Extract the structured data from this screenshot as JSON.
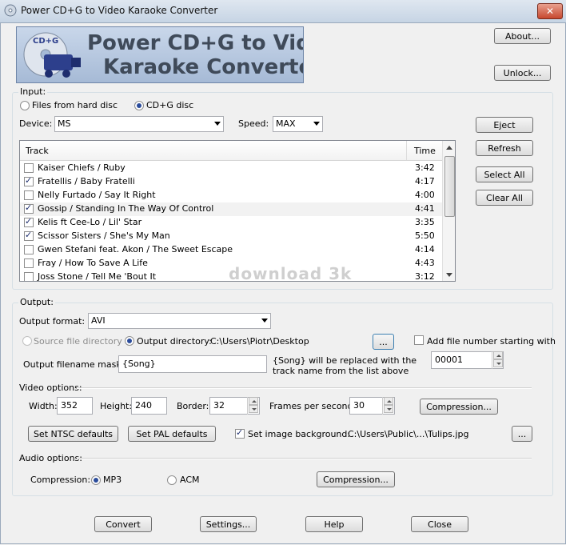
{
  "window": {
    "title": "Power CD+G to Video Karaoke Converter",
    "close_glyph": "✕"
  },
  "banner": {
    "line1": "Power CD+G to Video",
    "line2": "Karaoke Converter",
    "logo_text": "CD+G"
  },
  "buttons": {
    "about": "About...",
    "unlock": "Unlock...",
    "eject": "Eject",
    "refresh": "Refresh",
    "select_all": "Select All",
    "clear_all": "Clear All"
  },
  "input": {
    "group_label": "Input:",
    "source_hdd": "Files from hard disc",
    "source_cdg": "CD+G disc",
    "device_label": "Device:",
    "device_value": "MS",
    "speed_label": "Speed:",
    "speed_value": "MAX"
  },
  "tracklist": {
    "col_track": "Track",
    "col_time": "Time",
    "rows": [
      {
        "name": "Kaiser Chiefs / Ruby",
        "time": "3:42",
        "checked": false
      },
      {
        "name": "Fratellis / Baby Fratelli",
        "time": "4:17",
        "checked": true
      },
      {
        "name": "Nelly Furtado / Say It Right",
        "time": "4:00",
        "checked": false
      },
      {
        "name": "Gossip / Standing In The Way Of Control",
        "time": "4:41",
        "checked": true
      },
      {
        "name": "Kelis ft Cee-Lo / Lil' Star",
        "time": "3:35",
        "checked": true
      },
      {
        "name": "Scissor Sisters / She's My Man",
        "time": "5:50",
        "checked": true
      },
      {
        "name": "Gwen Stefani feat. Akon / The Sweet Escape",
        "time": "4:14",
        "checked": false
      },
      {
        "name": "Fray / How To Save A Life",
        "time": "4:43",
        "checked": false
      },
      {
        "name": "Joss Stone / Tell Me 'Bout It",
        "time": "3:12",
        "checked": false
      }
    ]
  },
  "watermark": "download 3k",
  "output": {
    "group_label": "Output:",
    "format_label": "Output format:",
    "format_value": "AVI",
    "source_dir_label": "Source file directory",
    "output_dir_label": "Output directory:",
    "output_dir_value": "C:\\Users\\Piotr\\Desktop",
    "browse": "...",
    "add_number_label": "Add file number starting with",
    "number_value": "00001",
    "mask_label": "Output filename mask:",
    "mask_value": "{Song}",
    "mask_hint_1": "{Song} will be replaced with the",
    "mask_hint_2": "track name from the list above"
  },
  "video": {
    "label": "Video options:",
    "width_label": "Width:",
    "width_value": "352",
    "height_label": "Height:",
    "height_value": "240",
    "border_label": "Border:",
    "border_value": "32",
    "fps_label": "Frames per second:",
    "fps_value": "30",
    "compression": "Compression...",
    "ntsc": "Set NTSC defaults",
    "pal": "Set PAL defaults",
    "set_bg_label": "Set image background:",
    "bg_path": "C:\\Users\\Public\\...\\Tulips.jpg",
    "browse": "..."
  },
  "audio": {
    "label": "Audio options:",
    "compression_label": "Compression:",
    "mp3": "MP3",
    "acm": "ACM",
    "compression_btn": "Compression..."
  },
  "footer": {
    "convert": "Convert",
    "settings": "Settings...",
    "help": "Help",
    "close": "Close"
  }
}
